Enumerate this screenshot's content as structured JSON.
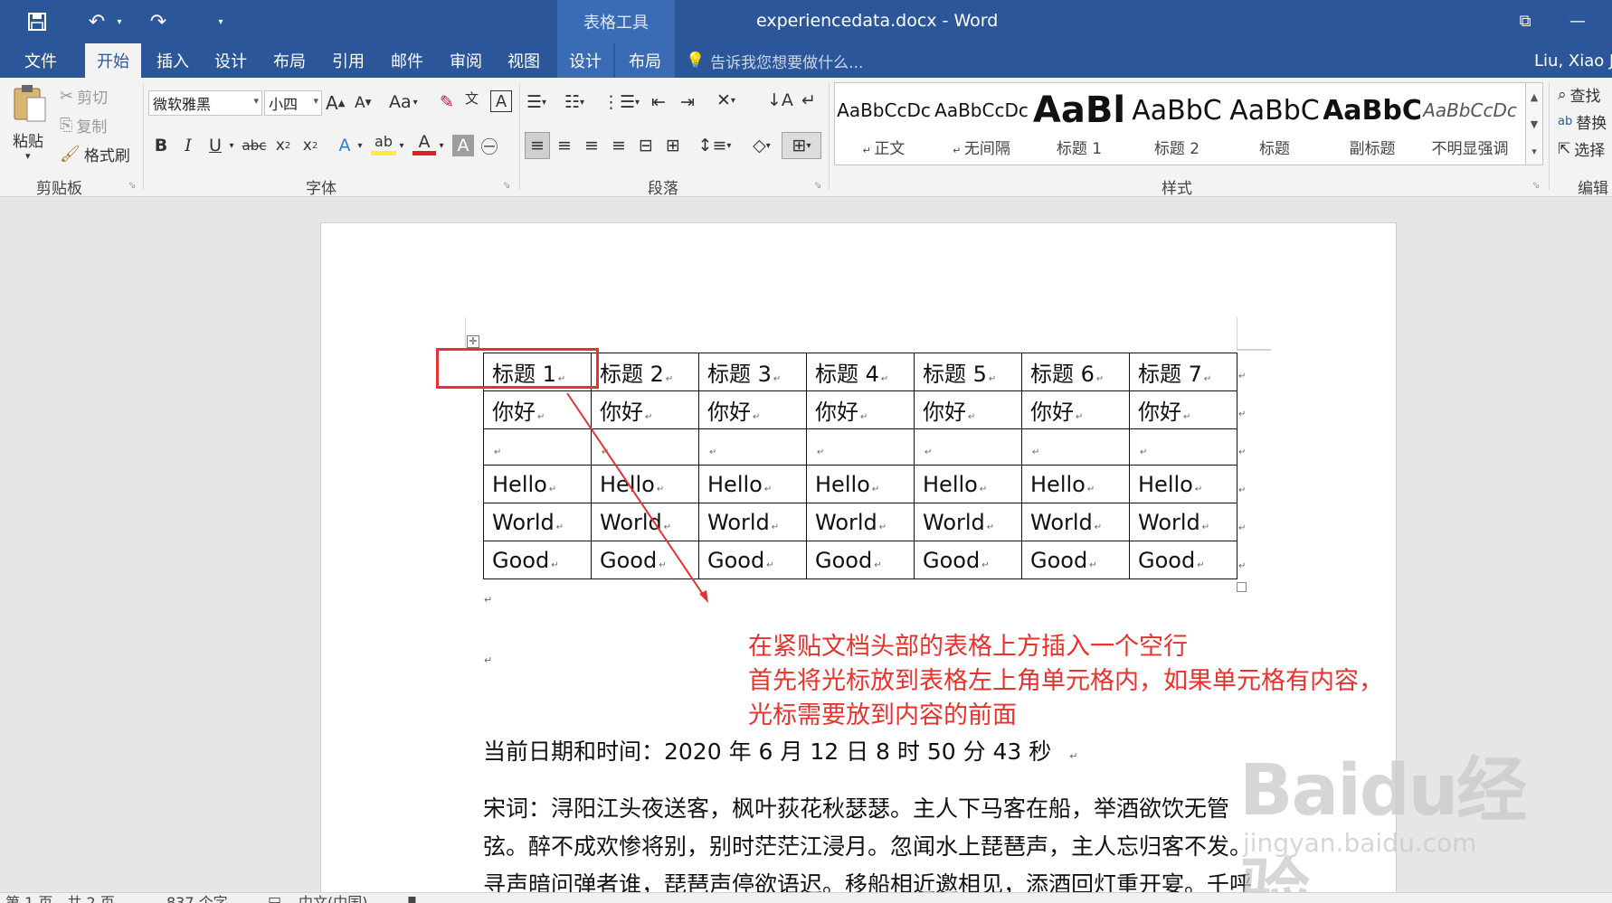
{
  "window": {
    "title": "experiencedata.docx - Word",
    "context_tab_group": "表格工具",
    "user": "Liu, Xiao J"
  },
  "quick_access": {
    "icons": [
      "save-icon",
      "undo-icon",
      "redo-icon",
      "customize-icon"
    ]
  },
  "tabs": [
    "文件",
    "开始",
    "插入",
    "设计",
    "布局",
    "引用",
    "邮件",
    "审阅",
    "视图",
    "设计",
    "布局"
  ],
  "active_tab": "开始",
  "tell_me": "告诉我您想要做什么...",
  "ribbon": {
    "clipboard": {
      "label": "剪贴板",
      "paste": "粘贴",
      "cut": "剪切",
      "copy": "复制",
      "format_painter": "格式刷"
    },
    "font": {
      "label": "字体",
      "font_name": "微软雅黑",
      "font_size": "小四",
      "change_case": "Aa"
    },
    "paragraph": {
      "label": "段落"
    },
    "styles": {
      "label": "样式",
      "items": [
        {
          "preview": "AaBbCcDc",
          "name": "正文"
        },
        {
          "preview": "AaBbCcDc",
          "name": "无间隔"
        },
        {
          "preview": "AaBl",
          "name": "标题 1"
        },
        {
          "preview": "AaBbC",
          "name": "标题 2"
        },
        {
          "preview": "AaBbC",
          "name": "标题"
        },
        {
          "preview": "AaBbC",
          "name": "副标题"
        },
        {
          "preview": "AaBbCcDc",
          "name": "不明显强调"
        }
      ]
    },
    "editing": {
      "label": "编辑",
      "find": "查找",
      "replace": "替换",
      "select": "选择"
    }
  },
  "document": {
    "table": [
      [
        "标题 1",
        "标题 2",
        "标题 3",
        "标题 4",
        "标题 5",
        "标题 6",
        "标题 7"
      ],
      [
        "你好",
        "你好",
        "你好",
        "你好",
        "你好",
        "你好",
        "你好"
      ],
      [
        "",
        "",
        "",
        "",
        "",
        "",
        ""
      ],
      [
        "Hello",
        "Hello",
        "Hello",
        "Hello",
        "Hello",
        "Hello",
        "Hello"
      ],
      [
        "World",
        "World",
        "World",
        "World",
        "World",
        "World",
        "World"
      ],
      [
        "Good",
        "Good",
        "Good",
        "Good",
        "Good",
        "Good",
        "Good"
      ]
    ],
    "annotation": [
      "在紧贴文档头部的表格上方插入一个空行",
      "首先将光标放到表格左上角单元格内，如果单元格有内容，",
      "光标需要放到内容的前面"
    ],
    "datetime_line": "当前日期和时间：2020 年 6 月 12 日  8 时 50 分 43 秒",
    "poem_lines": [
      "宋词：浔阳江头夜送客，枫叶荻花秋瑟瑟。主人下马客在船，举酒欲饮无管",
      "弦。醉不成欢惨将别，别时茫茫江浸月。忽闻水上琵琶声，主人忘归客不发。",
      "寻声暗问弹者谁，琵琶声停欲语迟。移船相近邀相见，添酒回灯重开宴。千呼"
    ],
    "paragraph_mark": "↵"
  },
  "statusbar": {
    "page": "第 1 页，共 2 页",
    "words": "837 个字",
    "language": "中文(中国)"
  },
  "watermark": {
    "logo": "Baidu经验",
    "url": "jingyan.baidu.com"
  },
  "colors": {
    "title_bar": "#2b579a",
    "context_tab": "#3a6bb5",
    "annotation": "#e8322c",
    "highlight_box": "#e53333"
  }
}
